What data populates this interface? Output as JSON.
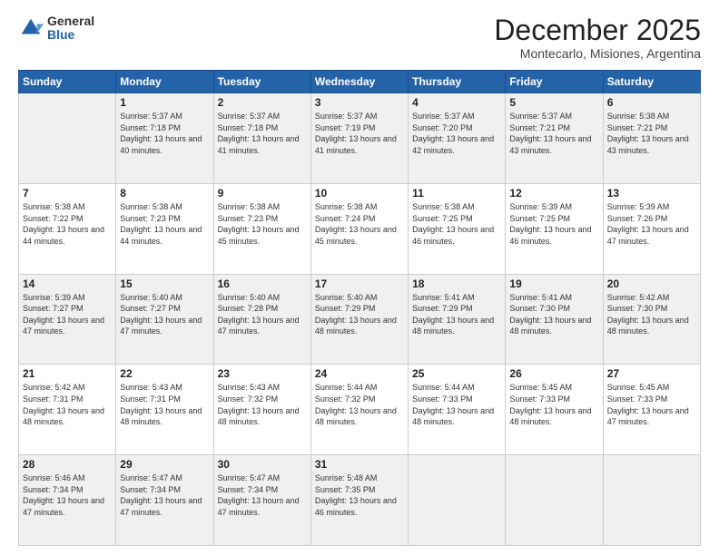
{
  "logo": {
    "general": "General",
    "blue": "Blue"
  },
  "title": "December 2025",
  "subtitle": "Montecarlo, Misiones, Argentina",
  "weekdays": [
    "Sunday",
    "Monday",
    "Tuesday",
    "Wednesday",
    "Thursday",
    "Friday",
    "Saturday"
  ],
  "rows": [
    [
      {
        "day": "",
        "sunrise": "",
        "sunset": "",
        "daylight": "",
        "empty": true
      },
      {
        "day": "1",
        "sunrise": "Sunrise: 5:37 AM",
        "sunset": "Sunset: 7:18 PM",
        "daylight": "Daylight: 13 hours and 40 minutes."
      },
      {
        "day": "2",
        "sunrise": "Sunrise: 5:37 AM",
        "sunset": "Sunset: 7:18 PM",
        "daylight": "Daylight: 13 hours and 41 minutes."
      },
      {
        "day": "3",
        "sunrise": "Sunrise: 5:37 AM",
        "sunset": "Sunset: 7:19 PM",
        "daylight": "Daylight: 13 hours and 41 minutes."
      },
      {
        "day": "4",
        "sunrise": "Sunrise: 5:37 AM",
        "sunset": "Sunset: 7:20 PM",
        "daylight": "Daylight: 13 hours and 42 minutes."
      },
      {
        "day": "5",
        "sunrise": "Sunrise: 5:37 AM",
        "sunset": "Sunset: 7:21 PM",
        "daylight": "Daylight: 13 hours and 43 minutes."
      },
      {
        "day": "6",
        "sunrise": "Sunrise: 5:38 AM",
        "sunset": "Sunset: 7:21 PM",
        "daylight": "Daylight: 13 hours and 43 minutes."
      }
    ],
    [
      {
        "day": "7",
        "sunrise": "Sunrise: 5:38 AM",
        "sunset": "Sunset: 7:22 PM",
        "daylight": "Daylight: 13 hours and 44 minutes."
      },
      {
        "day": "8",
        "sunrise": "Sunrise: 5:38 AM",
        "sunset": "Sunset: 7:23 PM",
        "daylight": "Daylight: 13 hours and 44 minutes."
      },
      {
        "day": "9",
        "sunrise": "Sunrise: 5:38 AM",
        "sunset": "Sunset: 7:23 PM",
        "daylight": "Daylight: 13 hours and 45 minutes."
      },
      {
        "day": "10",
        "sunrise": "Sunrise: 5:38 AM",
        "sunset": "Sunset: 7:24 PM",
        "daylight": "Daylight: 13 hours and 45 minutes."
      },
      {
        "day": "11",
        "sunrise": "Sunrise: 5:38 AM",
        "sunset": "Sunset: 7:25 PM",
        "daylight": "Daylight: 13 hours and 46 minutes."
      },
      {
        "day": "12",
        "sunrise": "Sunrise: 5:39 AM",
        "sunset": "Sunset: 7:25 PM",
        "daylight": "Daylight: 13 hours and 46 minutes."
      },
      {
        "day": "13",
        "sunrise": "Sunrise: 5:39 AM",
        "sunset": "Sunset: 7:26 PM",
        "daylight": "Daylight: 13 hours and 47 minutes."
      }
    ],
    [
      {
        "day": "14",
        "sunrise": "Sunrise: 5:39 AM",
        "sunset": "Sunset: 7:27 PM",
        "daylight": "Daylight: 13 hours and 47 minutes."
      },
      {
        "day": "15",
        "sunrise": "Sunrise: 5:40 AM",
        "sunset": "Sunset: 7:27 PM",
        "daylight": "Daylight: 13 hours and 47 minutes."
      },
      {
        "day": "16",
        "sunrise": "Sunrise: 5:40 AM",
        "sunset": "Sunset: 7:28 PM",
        "daylight": "Daylight: 13 hours and 47 minutes."
      },
      {
        "day": "17",
        "sunrise": "Sunrise: 5:40 AM",
        "sunset": "Sunset: 7:29 PM",
        "daylight": "Daylight: 13 hours and 48 minutes."
      },
      {
        "day": "18",
        "sunrise": "Sunrise: 5:41 AM",
        "sunset": "Sunset: 7:29 PM",
        "daylight": "Daylight: 13 hours and 48 minutes."
      },
      {
        "day": "19",
        "sunrise": "Sunrise: 5:41 AM",
        "sunset": "Sunset: 7:30 PM",
        "daylight": "Daylight: 13 hours and 48 minutes."
      },
      {
        "day": "20",
        "sunrise": "Sunrise: 5:42 AM",
        "sunset": "Sunset: 7:30 PM",
        "daylight": "Daylight: 13 hours and 48 minutes."
      }
    ],
    [
      {
        "day": "21",
        "sunrise": "Sunrise: 5:42 AM",
        "sunset": "Sunset: 7:31 PM",
        "daylight": "Daylight: 13 hours and 48 minutes."
      },
      {
        "day": "22",
        "sunrise": "Sunrise: 5:43 AM",
        "sunset": "Sunset: 7:31 PM",
        "daylight": "Daylight: 13 hours and 48 minutes."
      },
      {
        "day": "23",
        "sunrise": "Sunrise: 5:43 AM",
        "sunset": "Sunset: 7:32 PM",
        "daylight": "Daylight: 13 hours and 48 minutes."
      },
      {
        "day": "24",
        "sunrise": "Sunrise: 5:44 AM",
        "sunset": "Sunset: 7:32 PM",
        "daylight": "Daylight: 13 hours and 48 minutes."
      },
      {
        "day": "25",
        "sunrise": "Sunrise: 5:44 AM",
        "sunset": "Sunset: 7:33 PM",
        "daylight": "Daylight: 13 hours and 48 minutes."
      },
      {
        "day": "26",
        "sunrise": "Sunrise: 5:45 AM",
        "sunset": "Sunset: 7:33 PM",
        "daylight": "Daylight: 13 hours and 48 minutes."
      },
      {
        "day": "27",
        "sunrise": "Sunrise: 5:45 AM",
        "sunset": "Sunset: 7:33 PM",
        "daylight": "Daylight: 13 hours and 47 minutes."
      }
    ],
    [
      {
        "day": "28",
        "sunrise": "Sunrise: 5:46 AM",
        "sunset": "Sunset: 7:34 PM",
        "daylight": "Daylight: 13 hours and 47 minutes."
      },
      {
        "day": "29",
        "sunrise": "Sunrise: 5:47 AM",
        "sunset": "Sunset: 7:34 PM",
        "daylight": "Daylight: 13 hours and 47 minutes."
      },
      {
        "day": "30",
        "sunrise": "Sunrise: 5:47 AM",
        "sunset": "Sunset: 7:34 PM",
        "daylight": "Daylight: 13 hours and 47 minutes."
      },
      {
        "day": "31",
        "sunrise": "Sunrise: 5:48 AM",
        "sunset": "Sunset: 7:35 PM",
        "daylight": "Daylight: 13 hours and 46 minutes."
      },
      {
        "day": "",
        "sunrise": "",
        "sunset": "",
        "daylight": "",
        "empty": true
      },
      {
        "day": "",
        "sunrise": "",
        "sunset": "",
        "daylight": "",
        "empty": true
      },
      {
        "day": "",
        "sunrise": "",
        "sunset": "",
        "daylight": "",
        "empty": true
      }
    ]
  ]
}
